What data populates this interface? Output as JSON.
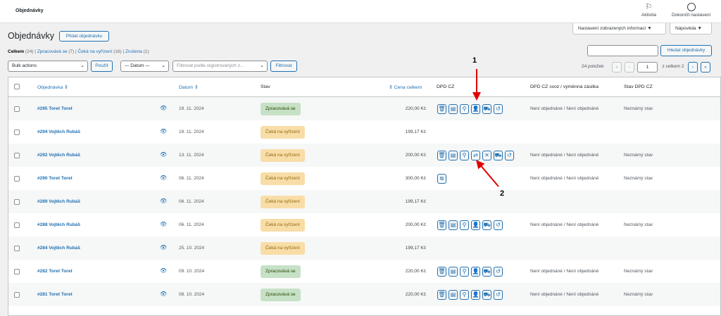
{
  "topbar": {
    "title": "Objednávky",
    "activity_label": "Aktivita",
    "finish_setup_label": "Dokončit nastavení"
  },
  "screen_options": {
    "screen_label": "Nastavení zobrazených informací ▼",
    "help_label": "Nápověda ▼"
  },
  "page": {
    "heading": "Objednávky",
    "add_button": "Přidat objednávku"
  },
  "status_filters": [
    {
      "label": "Celkem",
      "count": "(24)"
    },
    {
      "label": "Zpracovává se",
      "count": "(7)"
    },
    {
      "label": "Čeká na vyřízení",
      "count": "(16)"
    },
    {
      "label": "Zrušena",
      "count": "(1)"
    }
  ],
  "toolbar": {
    "bulk_actions": "Bulk actions",
    "apply": "Použít",
    "date_filter": "— Datum —",
    "customer_placeholder": "Filtrovat podle registrovaných z...",
    "filter_button": "Filtrovat",
    "search_button": "Hledat objednávky",
    "search_value": ""
  },
  "pagination": {
    "items": "24 položek",
    "first": "«",
    "prev": "‹",
    "current_page": "1",
    "of_total": "z celkem 2",
    "next": "›",
    "last": "»"
  },
  "columns": {
    "order": "Objednávka ⇕",
    "date": "Datum ⇕",
    "status": "Stav",
    "total": "⇕ Cena celkem",
    "dpd": "DPD CZ",
    "dpd_pickup": "DPD CZ svoz / výměnná zásilka",
    "dpd_state": "Stav DPD CZ"
  },
  "rows": [
    {
      "order": "#295 Toret Toret",
      "date": "19. 11. 2024",
      "status": "Zpracovává se",
      "status_type": "processing",
      "total": "220,00 Kč",
      "dpd_buttons": [
        "trash",
        "doc",
        "search",
        "person",
        "truck",
        "undo"
      ],
      "pickup": "Není objednáné / Není objednáné",
      "dpd_status": "Neznámý stav"
    },
    {
      "order": "#294 Vojtěch Rubáš",
      "date": "18. 11. 2024",
      "status": "Čeká na vyřízení",
      "status_type": "onhold",
      "total": "199,17 Kč",
      "dpd_buttons": [],
      "pickup": "",
      "dpd_status": ""
    },
    {
      "order": "#292 Vojtěch Rubáš",
      "date": "13. 11. 2024",
      "status": "Čeká na vyřízení",
      "status_type": "onhold",
      "total": "200,00 Kč",
      "dpd_buttons": [
        "trash",
        "doc",
        "search",
        "swap",
        "close",
        "truck",
        "undo"
      ],
      "pickup": "Není objednáné / Není objednáné",
      "dpd_status": "Neznámý stav"
    },
    {
      "order": "#290 Toret Toret",
      "date": "06. 11. 2024",
      "status": "Čeká na vyřízení",
      "status_type": "onhold",
      "total": "300,00 Kč",
      "dpd_buttons": [
        "external"
      ],
      "pickup": "Není objednáné / Není objednáné",
      "dpd_status": "Neznámý stav"
    },
    {
      "order": "#289 Vojtěch Rubáš",
      "date": "06. 11. 2024",
      "status": "Čeká na vyřízení",
      "status_type": "onhold",
      "total": "199,17 Kč",
      "dpd_buttons": [],
      "pickup": "",
      "dpd_status": ""
    },
    {
      "order": "#288 Vojtěch Rubáš",
      "date": "06. 11. 2024",
      "status": "Čeká na vyřízení",
      "status_type": "onhold",
      "total": "200,00 Kč",
      "dpd_buttons": [
        "trash",
        "doc",
        "search",
        "person",
        "truck",
        "undo"
      ],
      "pickup": "Není objednáné / Není objednáné",
      "dpd_status": "Neznámý stav"
    },
    {
      "order": "#284 Vojtěch Rubáš",
      "date": "25. 10. 2024",
      "status": "Čeká na vyřízení",
      "status_type": "onhold",
      "total": "199,17 Kč",
      "dpd_buttons": [],
      "pickup": "",
      "dpd_status": ""
    },
    {
      "order": "#282 Toret Toret",
      "date": "09. 10. 2024",
      "status": "Zpracovává se",
      "status_type": "processing",
      "total": "220,00 Kč",
      "dpd_buttons": [
        "trash",
        "doc",
        "search",
        "person",
        "truck",
        "undo"
      ],
      "pickup": "Není objednáné / Není objednáné",
      "dpd_status": "Neznámý stav"
    },
    {
      "order": "#281 Toret Toret",
      "date": "08. 10. 2024",
      "status": "Zpracovává se",
      "status_type": "processing",
      "total": "220,00 Kč",
      "dpd_buttons": [
        "trash",
        "doc",
        "search",
        "person",
        "truck",
        "undo"
      ],
      "pickup": "Není objednáné / Není objednáné",
      "dpd_status": "Neznámý stav"
    }
  ],
  "annotations": [
    {
      "label": "1",
      "color": "#e00000"
    },
    {
      "label": "2",
      "color": "#e00000"
    }
  ],
  "colors": {
    "accent": "#2271b1",
    "processing_bg": "#c6e1c6",
    "onhold_bg": "#f8dda7",
    "arrow": "#e00000"
  }
}
